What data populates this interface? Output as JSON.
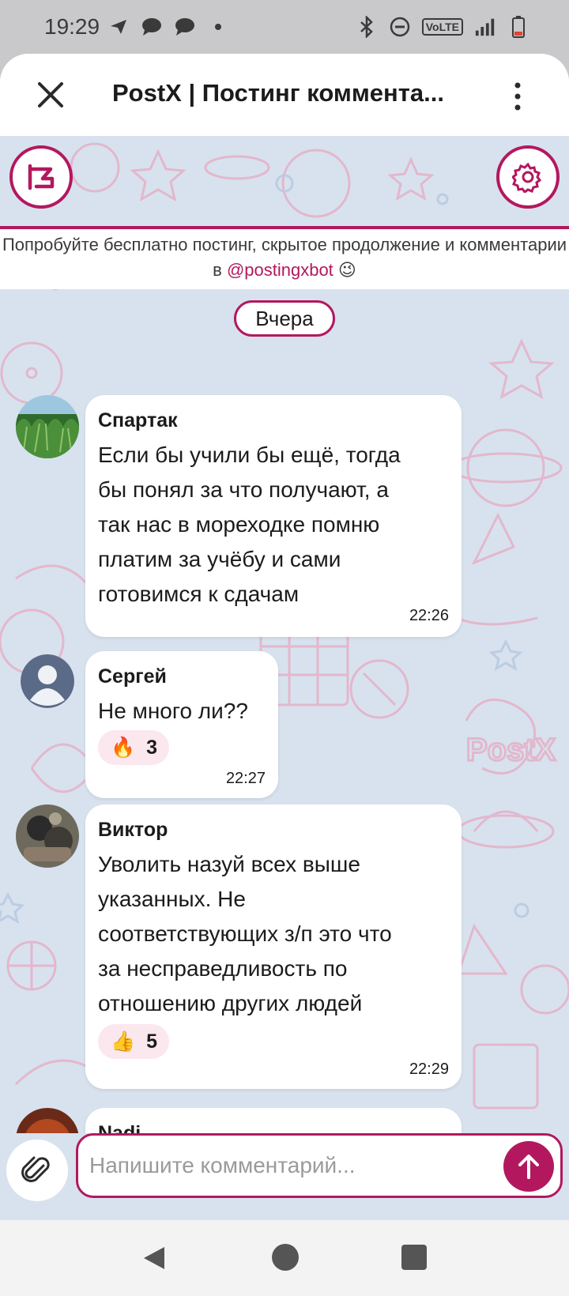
{
  "status_bar": {
    "time": "19:29",
    "left_icons": [
      "telegram-icon",
      "chat-bubble-icon",
      "chat-bubble-icon",
      "dot-icon"
    ],
    "network_label": "VoLTE",
    "right_icons": [
      "bluetooth-icon",
      "dnd-icon",
      "volte-icon",
      "signal-icon",
      "battery-icon"
    ]
  },
  "header": {
    "title": "PostX | Постинг коммента..."
  },
  "promo": {
    "text_before": "Попробуйте бесплатно постинг, скрытое продолжение и комментарии в ",
    "link": "@postingxbot",
    "emoji": "😉"
  },
  "date_separator": "Вчера",
  "messages": [
    {
      "author": "Спартак",
      "text": "Если бы учили бы ещё, тогда\nбы понял за что получают, а\nтак нас в мореходке помню\nплатим за учёбу и сами\nготовимся к сдачам",
      "time": "22:26"
    },
    {
      "author": "Сергей",
      "text": "Не много ли??",
      "reaction_emoji": "🔥",
      "reaction_count": "3",
      "time": "22:27"
    },
    {
      "author": "Виктор",
      "text": "Уволить назуй всех выше\nуказанных. Не\nсоответствующих з/п это что\nза несправедливость по\nотношению других людей",
      "reaction_emoji": "👍",
      "reaction_count": "5",
      "time": "22:29"
    },
    {
      "author": "Nadi",
      "text": ""
    }
  ],
  "composer": {
    "placeholder": "Напишите комментарий..."
  },
  "colors": {
    "accent": "#b3185f",
    "chat_bg": "#d7e2ee",
    "reaction_bg": "#fbe7ee"
  }
}
